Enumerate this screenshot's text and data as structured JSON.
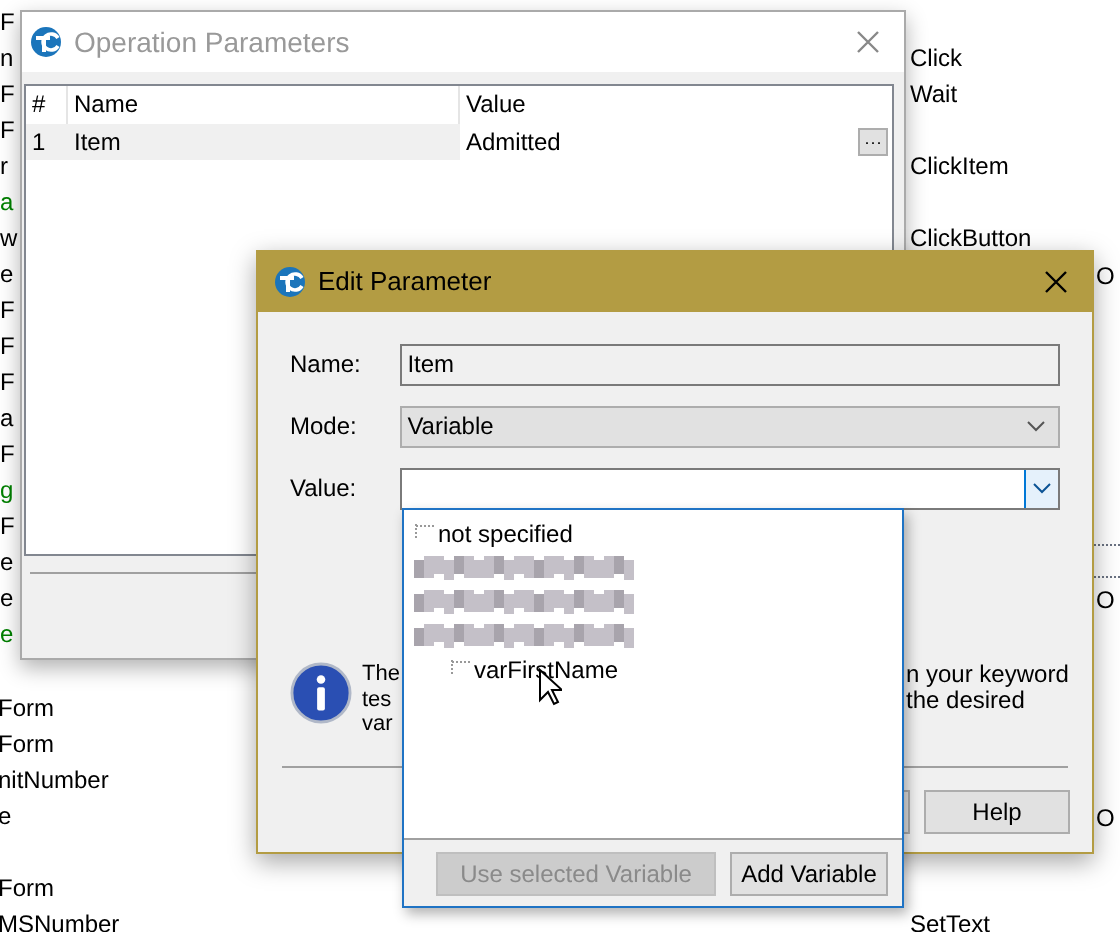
{
  "background": {
    "left_fragments_top": [
      {
        "text": "F",
        "color": "#000000"
      },
      {
        "text": "n",
        "color": "#000000"
      },
      {
        "text": "F",
        "color": "#000000"
      },
      {
        "text": "F",
        "color": "#000000"
      },
      {
        "text": "r",
        "color": "#000000"
      },
      {
        "text": "a",
        "color": "#008000"
      },
      {
        "text": "w",
        "color": "#000000"
      },
      {
        "text": "e",
        "color": "#000000"
      },
      {
        "text": "F",
        "color": "#000000"
      },
      {
        "text": "F",
        "color": "#000000"
      },
      {
        "text": "F",
        "color": "#000000"
      },
      {
        "text": "a",
        "color": "#000000"
      },
      {
        "text": "F",
        "color": "#000000"
      },
      {
        "text": "g",
        "color": "#008000"
      },
      {
        "text": "F",
        "color": "#000000"
      },
      {
        "text": "e",
        "color": "#000000"
      },
      {
        "text": "e",
        "color": "#000000"
      },
      {
        "text": "e",
        "color": "#008000"
      }
    ],
    "left_texts_middle": [
      "Form",
      "Form",
      "nitNumber",
      "e"
    ],
    "left_texts_bottom": [
      "Form",
      "MSNumber"
    ],
    "right_texts": [
      "Click",
      "Wait",
      "ClickItem",
      "ClickButton"
    ],
    "right_fragments": [
      "O",
      "O",
      "O"
    ],
    "bottom_right_text": "SetText"
  },
  "operation_parameters": {
    "title": "Operation Parameters",
    "columns": [
      "#",
      "Name",
      "Value"
    ],
    "rows": [
      {
        "cells": [
          "1",
          "Item",
          "Admitted"
        ],
        "button": "···"
      }
    ]
  },
  "edit_parameter": {
    "title": "Edit Parameter",
    "fields": [
      {
        "kind": "text",
        "label": "Name:",
        "value": "Item"
      },
      {
        "kind": "combo",
        "label": "Mode:",
        "value": "Variable"
      },
      {
        "kind": "open_combo",
        "label": "Value:"
      }
    ],
    "info_left": [
      "The",
      "tes",
      "var"
    ],
    "info_right": [
      "n your keyword",
      "the desired"
    ],
    "help_button": "Help",
    "dropdown": {
      "tree": [
        {
          "kind": "item",
          "label": "not specified"
        },
        {
          "kind": "redacted"
        },
        {
          "kind": "redacted"
        },
        {
          "kind": "redacted",
          "children": [
            {
              "kind": "item",
              "label": "varFirstName"
            }
          ]
        }
      ],
      "buttons": [
        {
          "label": "Use selected Variable",
          "disabled": true
        },
        {
          "label": "Add Variable",
          "disabled": false
        }
      ]
    }
  }
}
